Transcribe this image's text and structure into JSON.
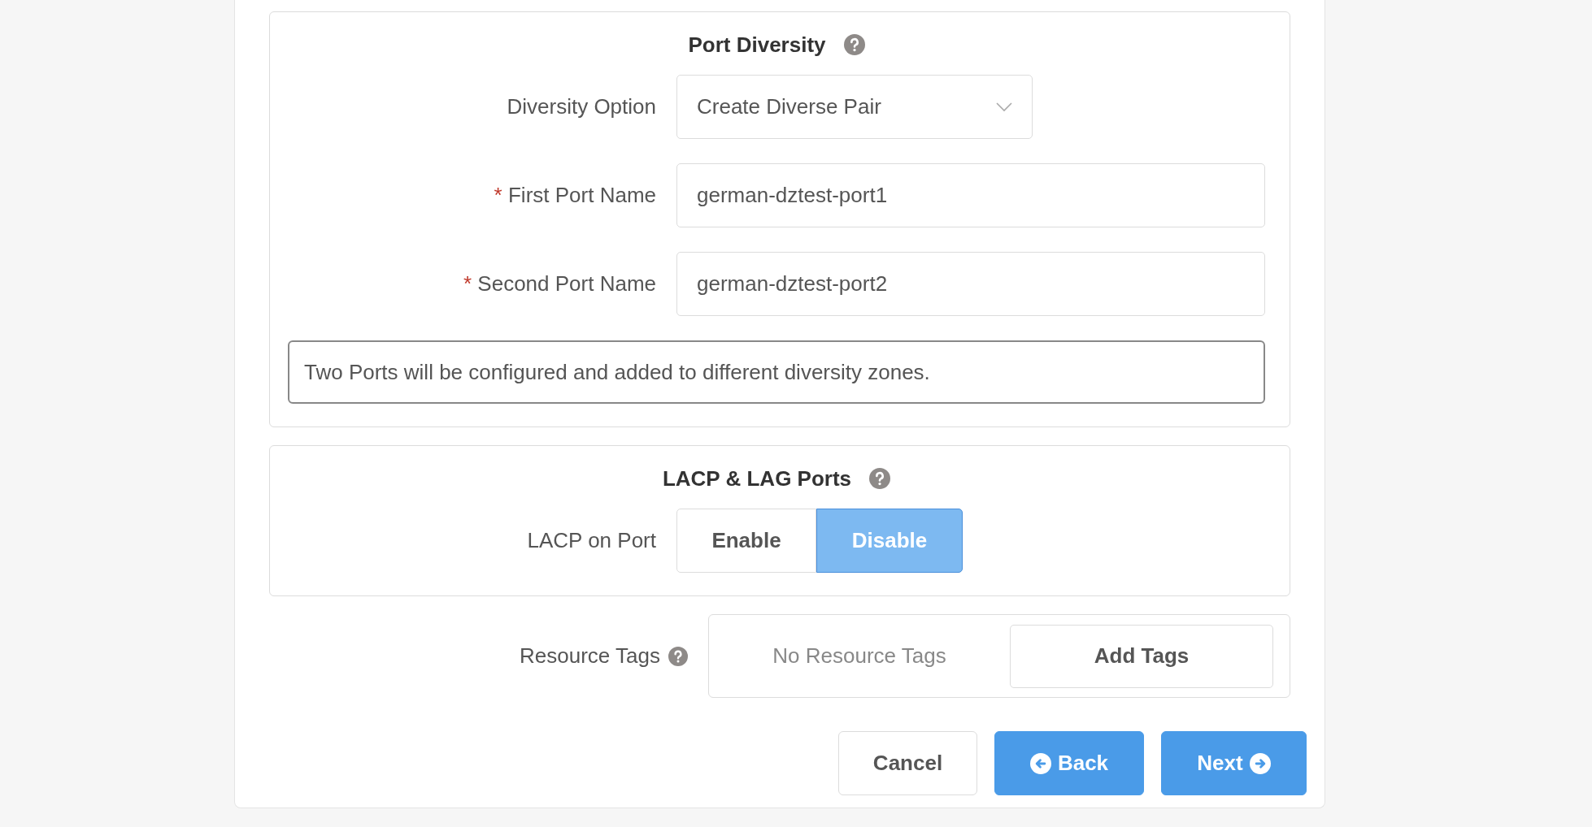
{
  "sections": [
    {
      "title": "Port Diversity",
      "fields": [
        {
          "kind": "select",
          "label": "Diversity Option",
          "value": "Create Diverse Pair"
        },
        {
          "kind": "text",
          "required_mark": "*",
          "label": "First Port Name",
          "value": "german-dztest-port1"
        },
        {
          "kind": "text",
          "required_mark": "*",
          "label": "Second Port Name",
          "value": "german-dztest-port2"
        }
      ],
      "note": "Two Ports will be configured and added to different diversity zones."
    },
    {
      "title": "LACP & LAG Ports",
      "fields": [
        {
          "kind": "toggle",
          "label": "LACP on Port",
          "options": [
            {
              "label": "Enable",
              "selected": false
            },
            {
              "label": "Disable",
              "selected": true
            }
          ]
        }
      ]
    }
  ],
  "resource_tags": {
    "label": "Resource Tags",
    "empty_text": "No Resource Tags",
    "button": "Add Tags"
  },
  "buttons": [
    {
      "label": "Cancel",
      "kind": "cancel"
    },
    {
      "label": "Back",
      "kind": "back"
    },
    {
      "label": "Next",
      "kind": "next"
    }
  ]
}
